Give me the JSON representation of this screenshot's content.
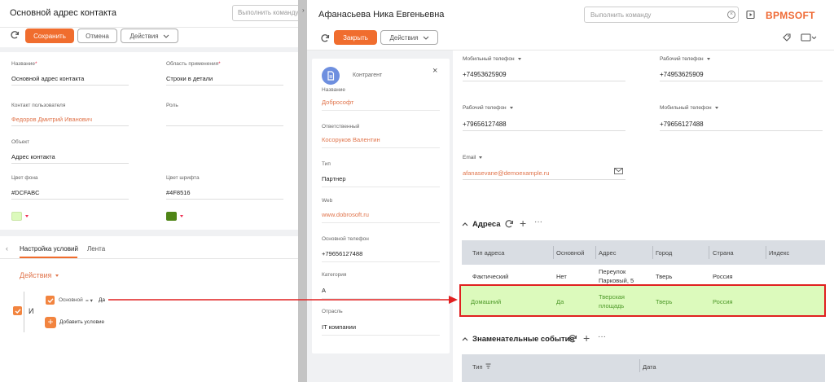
{
  "left": {
    "title": "Основной адрес контакта",
    "command_placeholder": "Выполнить команду",
    "toolbar": {
      "save_label": "Сохранить",
      "cancel_label": "Отмена",
      "actions_label": "Действия"
    },
    "fields": {
      "name": {
        "label": "Название",
        "value": "Основной адрес контакта"
      },
      "scope": {
        "label": "Область применения",
        "value": "Строки в детали"
      },
      "user_contact": {
        "label": "Контакт пользователя",
        "value": "Федоров Дмитрий Иванович"
      },
      "role": {
        "label": "Роль",
        "value": ""
      },
      "object": {
        "label": "Объект",
        "value": "Адрес контакта"
      },
      "bg_color": {
        "label": "Цвет фона",
        "value": "#DCFABC",
        "swatch": "#dcfabc"
      },
      "font_color": {
        "label": "Цвет шрифта",
        "value": "#4F8516",
        "swatch": "#4f8516"
      }
    },
    "tabs": {
      "conditions": "Настройка условий",
      "feed": "Лента"
    },
    "conditions": {
      "actions_label": "Действия",
      "group_operator": "И",
      "condition_field": "Основной",
      "condition_value": "Да",
      "add_condition": "Добавить условие"
    }
  },
  "right": {
    "title": "Афанасьева Ника Евгеньевна",
    "command_placeholder": "Выполнить команду",
    "brand": "BPMSOFT",
    "toolbar": {
      "close_label": "Закрыть",
      "actions_label": "Действия"
    },
    "card": {
      "entity_type": "Контрагент",
      "name": {
        "label": "Название",
        "value": "Добрософт"
      },
      "owner": {
        "label": "Ответственный",
        "value": "Косоруков Валентин"
      },
      "type": {
        "label": "Тип",
        "value": "Партнер"
      },
      "web": {
        "label": "Web",
        "value": "www.dobrosoft.ru"
      },
      "phone": {
        "label": "Основной телефон",
        "value": "+79656127488"
      },
      "category": {
        "label": "Категория",
        "value": "А"
      },
      "industry": {
        "label": "Отрасль",
        "value": "IT компании"
      }
    },
    "communications": [
      {
        "label": "Мобильный телефон",
        "value": "+74953625909"
      },
      {
        "label": "Рабочий телефон",
        "value": "+74953625909"
      },
      {
        "label": "Рабочий телефон",
        "value": "+79656127488"
      },
      {
        "label": "Мобильный телефон",
        "value": "+79656127488"
      },
      {
        "label": "Email",
        "value": "afanasevane@demoexample.ru"
      }
    ],
    "addresses": {
      "title": "Адреса",
      "columns": [
        "Тип адреса",
        "Основной",
        "Адрес",
        "Город",
        "Страна",
        "Индекс"
      ],
      "rows": [
        {
          "type": "Фактический",
          "primary": "Нет",
          "address_line1": "Переулок",
          "address_line2": "Парковый, 5",
          "city": "Тверь",
          "country": "Россия",
          "zip": ""
        },
        {
          "type": "Домашний",
          "primary": "Да",
          "address_line1": "Тверская",
          "address_line2": "площадь",
          "city": "Тверь",
          "country": "Россия",
          "zip": ""
        }
      ]
    },
    "events": {
      "title": "Знаменательные события",
      "columns": [
        "Тип",
        "Дата"
      ]
    }
  }
}
